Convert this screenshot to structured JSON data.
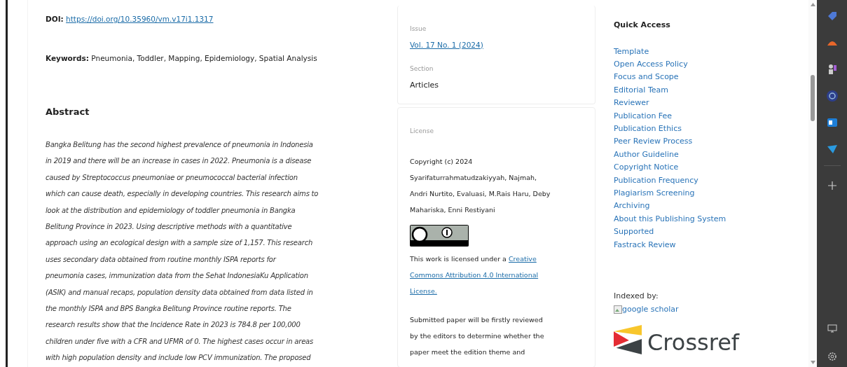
{
  "article": {
    "doi_label": "DOI:",
    "doi_link": "https://doi.org/10.35960/vm.v17i1.1317",
    "keywords_label": "Keywords:",
    "keywords": "Pneumonia, Toddler, Mapping, Epidemiology, Spatial Analysis",
    "abstract_heading": "Abstract",
    "abstract_lines": [
      "Bangka Belitung has the second highest prevalence of pneumonia in Indonesia",
      "in 2019 and there will be an increase in cases in 2022. Pneumonia is a disease",
      "caused by Streptococcus pneumoniae or pneumococcal bacterial infection",
      "which can cause death, especially in developing countries. This research aims to",
      "look at the distribution and epidemiology of toddler pneumonia in Bangka",
      "Belitung Province in 2023. Using descriptive methods with a quantitative",
      "approach using an ecological design with a sample size of 1,157. This research",
      "uses secondary data obtained from routine monthly ISPA reports for",
      "pneumonia cases, immunization data from the Sehat IndonesiaKu Application",
      "(ASIK) and manual recaps, population density data obtained from data listed in",
      "the monthly ISPA and BPS Bangka Belitung Province routine reports. The",
      "research results show that the Incidence Rate in 2023 is 784.8 per 100,000",
      "children under five with a CFR and UFMR of 0. The highest cases occur in areas",
      "with high population density and include low PCV immunization. The proposed"
    ]
  },
  "details": {
    "issue_label": "Issue",
    "issue_link": "Vol. 17 No. 1 (2024)",
    "section_label": "Section",
    "section_value": "Articles",
    "license_label": "License",
    "copyright_lines": [
      "Copyright (c) 2024",
      "Syarifaturrahmatudzakiyyah, Najmah,",
      "Andri Nurtito, Evaluasi, M.Rais Haru, Deby",
      "Mahariska, Enni Restiyani"
    ],
    "license_lines": [
      {
        "text": "This work is licensed under a ",
        "link": "Creative"
      },
      {
        "link": "Commons Attribution 4.0 International"
      },
      {
        "link": "License."
      }
    ],
    "review_lines": [
      "Submitted paper will be  firstly reviewed",
      "by the editors to determine whether the",
      "paper meet the edition theme and"
    ]
  },
  "quick_access": {
    "heading": "Quick Access",
    "links": [
      "Template",
      "Open Access Policy",
      "Focus and Scope",
      "Editorial Team",
      "Reviewer",
      "Publication Fee",
      "Publication Ethics",
      "Peer Review Process",
      "Author Guideline",
      "Copyright Notice",
      "Publication Frequency",
      "Plagiarism Screening",
      "Archiving",
      "About this Publishing System",
      "Supported",
      "Fastrack Review"
    ],
    "indexed_label": "Indexed by:",
    "broken_image_alt": "google scholar",
    "crossref_text": "Crossref"
  }
}
